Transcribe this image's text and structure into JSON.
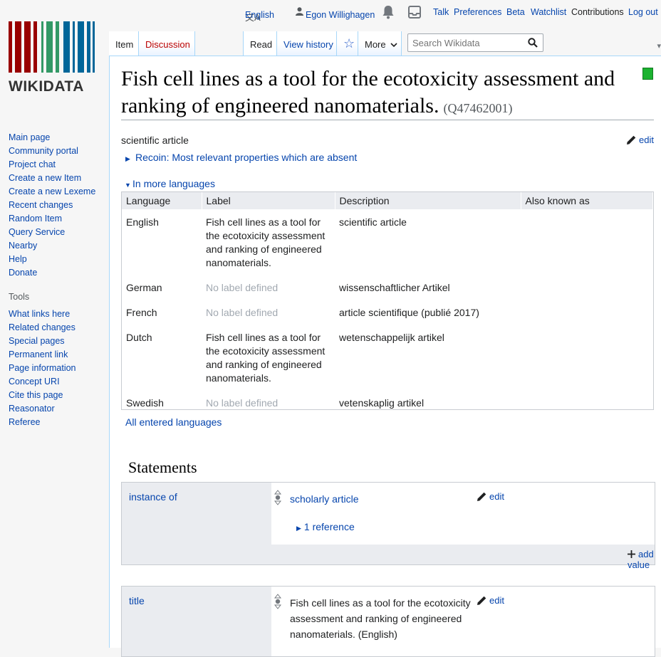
{
  "personal": {
    "language": "English",
    "user": "Egon Willighagen",
    "talk": "Talk",
    "preferences": "Preferences",
    "beta": "Beta",
    "watchlist": "Watchlist",
    "contributions": "Contributions",
    "logout": "Log out"
  },
  "logo": {
    "text": "WIKIDATA"
  },
  "sidebar": {
    "navigation": [
      "Main page",
      "Community portal",
      "Project chat",
      "Create a new Item",
      "Create a new Lexeme",
      "Recent changes",
      "Random Item",
      "Query Service",
      "Nearby",
      "Help",
      "Donate"
    ],
    "tools_heading": "Tools",
    "tools": [
      "What links here",
      "Related changes",
      "Special pages",
      "Permanent link",
      "Page information",
      "Concept URI",
      "Cite this page",
      "Reasonator",
      "Referee"
    ]
  },
  "tabs": {
    "item": "Item",
    "discussion": "Discussion",
    "read": "Read",
    "history": "View history",
    "more": "More"
  },
  "search": {
    "placeholder": "Search Wikidata"
  },
  "page": {
    "title": "Fish cell lines as a tool for the ecotoxicity assessment and ranking of engineered nanomaterials.",
    "qid": "(Q47462001)",
    "description": "scientific article",
    "edit": "edit",
    "recoin": "Recoin: Most relevant properties which are absent",
    "more_languages": "In more languages",
    "all_languages": "All entered languages"
  },
  "lang_table": {
    "headers": [
      "Language",
      "Label",
      "Description",
      "Also known as"
    ],
    "rows": [
      {
        "language": "English",
        "label": "Fish cell lines as a tool for the ecotoxicity assessment and ranking of engineered nanomaterials.",
        "label_defined": true,
        "description": "scientific article",
        "aliases": ""
      },
      {
        "language": "German",
        "label": "No label defined",
        "label_defined": false,
        "description": "wissenschaftlicher Artikel",
        "aliases": ""
      },
      {
        "language": "French",
        "label": "No label defined",
        "label_defined": false,
        "description": "article scientifique (publié 2017)",
        "aliases": ""
      },
      {
        "language": "Dutch",
        "label": "Fish cell lines as a tool for the ecotoxicity assessment and ranking of engineered nanomaterials.",
        "label_defined": true,
        "description": "wetenschappelijk artikel",
        "aliases": ""
      },
      {
        "language": "Swedish",
        "label": "No label defined",
        "label_defined": false,
        "description": "vetenskaplig artikel",
        "aliases": ""
      }
    ]
  },
  "statements": {
    "heading": "Statements",
    "instance_of": {
      "property": "instance of",
      "value": "scholarly article",
      "edit": "edit",
      "references": "1 reference",
      "add_value": "add value"
    },
    "title": {
      "property": "title",
      "value": "Fish cell lines as a tool for the ecotoxicity assessment and ranking of engineered nanomaterials. (English)",
      "edit": "edit"
    }
  },
  "colors": {
    "link": "#0645ad",
    "discussion_red": "#ba0000",
    "status_green": "#1cb230",
    "logo_red": "#990000",
    "logo_green": "#339966",
    "logo_blue": "#006699"
  }
}
